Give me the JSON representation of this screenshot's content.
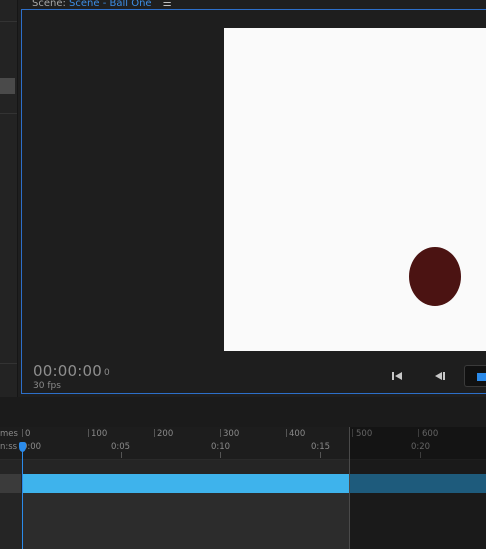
{
  "scene": {
    "label": "Scene:",
    "name": "Scene - Ball One",
    "menu_icon": "hamburger-menu-icon",
    "timecode": "00:00:00",
    "frame": "0",
    "fps": "30 fps"
  },
  "colors": {
    "accent": "#2b8bea",
    "canvas": "#fafafa",
    "ball": "#4b1312",
    "track": "#3eb3ec"
  },
  "controls": {
    "first_icon": "skip-to-start-icon",
    "prev_icon": "step-back-icon",
    "play_icon": "play-icon"
  },
  "timeline": {
    "frames_label": "mes",
    "time_label": "n:ss",
    "frame_ticks": [
      "0",
      "100",
      "200",
      "300",
      "400",
      "500",
      "600"
    ],
    "time_ticks": [
      "0:00",
      "0:05",
      "0:10",
      "0:15",
      "0:20"
    ]
  }
}
